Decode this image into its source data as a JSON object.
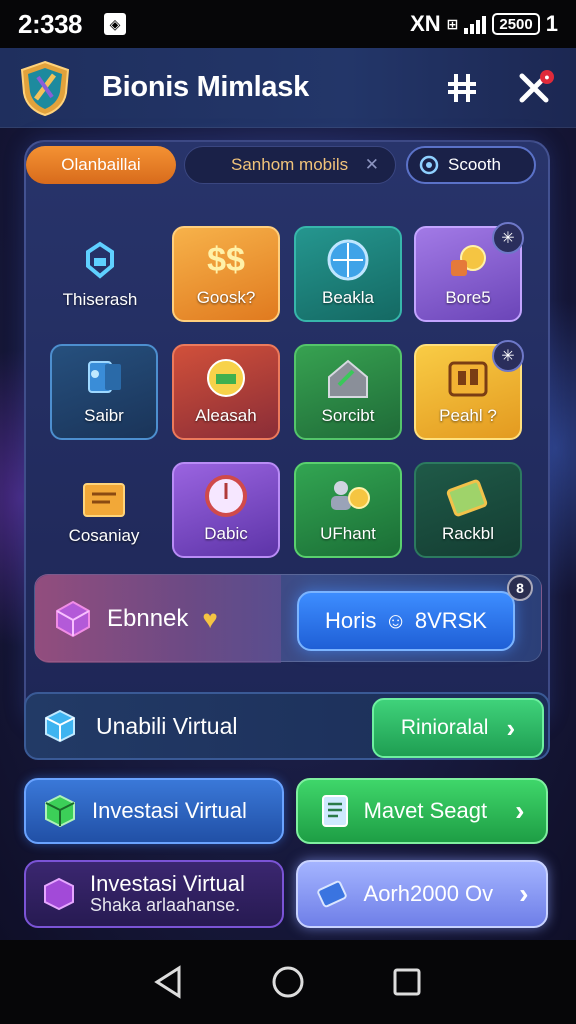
{
  "status": {
    "time": "2:338",
    "app_icon": "◈",
    "carrier": "XN",
    "battery": "2500",
    "battery_suffix": "1"
  },
  "header": {
    "title": "Bionis Mimlask"
  },
  "tabs": [
    {
      "label": "Olanbaillai"
    },
    {
      "label": "Sanhom mobils"
    },
    {
      "label": "Scooth"
    }
  ],
  "tiles": [
    {
      "label": "Thiserash",
      "icon": "tag-icon"
    },
    {
      "label": "Goosk?",
      "icon": "dollar-icon"
    },
    {
      "label": "Beakla",
      "icon": "globe-icon"
    },
    {
      "label": "Bore5",
      "icon": "coins-icon"
    },
    {
      "label": "Saibr",
      "icon": "robot-icon"
    },
    {
      "label": "Aleasah",
      "icon": "mail-icon"
    },
    {
      "label": "Sorcibt",
      "icon": "house-icon"
    },
    {
      "label": "Peahl ?",
      "icon": "wallet-icon"
    },
    {
      "label": "Cosaniay",
      "icon": "folder-icon"
    },
    {
      "label": "Dabic",
      "icon": "clock-icon"
    },
    {
      "label": "UFhant",
      "icon": "people-icon"
    },
    {
      "label": "Rackbl",
      "icon": "money-icon"
    }
  ],
  "banner": {
    "left_label": "Ebnnek",
    "button_label": "Horis",
    "button_suffix": "8VRSK",
    "close": "8"
  },
  "row1": {
    "label": "Unabili Virtual",
    "button_label": "Rinioralal"
  },
  "cards": [
    {
      "label": "Investasi Virtual"
    },
    {
      "label": "Mavet Seagt"
    },
    {
      "label": "Investasi Virtual",
      "sub": "Shaka arlaahanse."
    },
    {
      "label": "Aorh2000 Ov"
    }
  ],
  "colors": {
    "accent_orange": "#f49233",
    "accent_green": "#3fd27a",
    "accent_blue": "#3d8dff"
  }
}
